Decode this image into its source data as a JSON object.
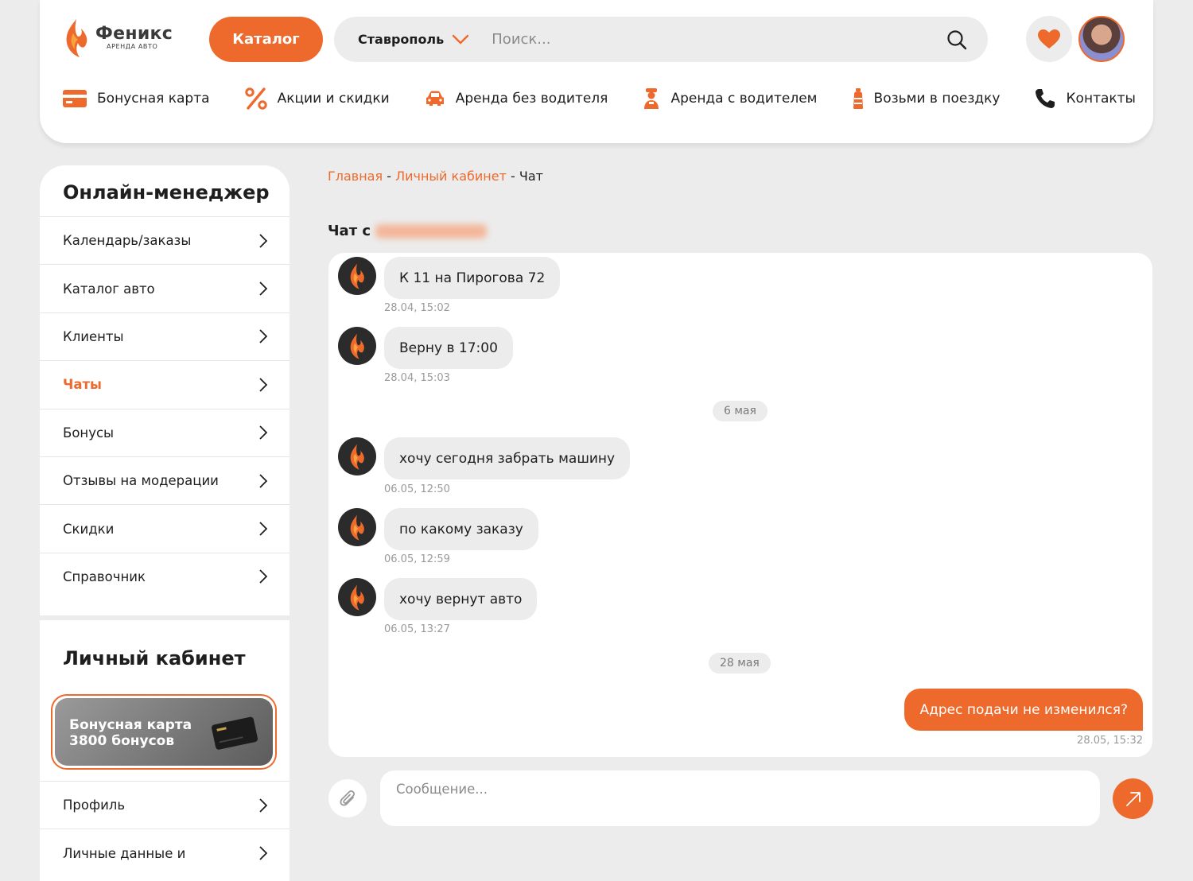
{
  "colors": {
    "accent": "#ee6a2c",
    "background": "#ececec",
    "surface": "#ffffff",
    "text": "#1e1e1e",
    "muted": "#9a9a9a"
  },
  "header": {
    "logo_name": "Феникс",
    "logo_sub": "АРЕНДА АВТО",
    "catalog_label": "Каталог",
    "city": "Ставрополь",
    "search_placeholder": "Поиск...",
    "nav": [
      {
        "label": "Бонусная карта",
        "icon": "card-icon"
      },
      {
        "label": "Акции и скидки",
        "icon": "percent-icon"
      },
      {
        "label": "Аренда без водителя",
        "icon": "car-icon"
      },
      {
        "label": "Аренда с водителем",
        "icon": "driver-icon"
      },
      {
        "label": "Возьми в поездку",
        "icon": "bottle-icon"
      },
      {
        "label": "Контакты",
        "icon": "phone-icon"
      }
    ]
  },
  "sidebar": {
    "manager_title": "Онлайн-менеджер",
    "manager_items": [
      {
        "label": "Календарь/заказы"
      },
      {
        "label": "Каталог авто"
      },
      {
        "label": "Клиенты"
      },
      {
        "label": "Чаты",
        "active": true
      },
      {
        "label": "Бонусы"
      },
      {
        "label": "Отзывы на модерации"
      },
      {
        "label": "Скидки"
      },
      {
        "label": "Справочник"
      }
    ],
    "cabinet_title": "Личный кабинет",
    "bonus_card": {
      "line1": "Бонусная карта",
      "line2": "3800 бонусов"
    },
    "cabinet_items": [
      {
        "label": "Профиль"
      },
      {
        "label": "Личные данные и"
      }
    ]
  },
  "breadcrumb": {
    "home": "Главная",
    "cabinet": "Личный кабинет",
    "current": "Чат",
    "separator": "-"
  },
  "chat": {
    "title_prefix": "Чат с",
    "messages": [
      {
        "text": "К 11 на Пирогова 72",
        "time": "28.04, 15:02"
      },
      {
        "text": "Верну в 17:00",
        "time": "28.04, 15:03"
      },
      {
        "date": "6 мая"
      },
      {
        "text": "хочу сегодня забрать машину",
        "time": "06.05, 12:50"
      },
      {
        "text": "по какому заказу",
        "time": "06.05, 12:59"
      },
      {
        "text": "хочу вернут авто",
        "time": "06.05, 13:27"
      },
      {
        "date": "28 мая"
      }
    ],
    "outgoing": {
      "text": "Адрес подачи не изменился?",
      "time": "28.05, 15:32"
    },
    "input_placeholder": "Сообщение..."
  }
}
